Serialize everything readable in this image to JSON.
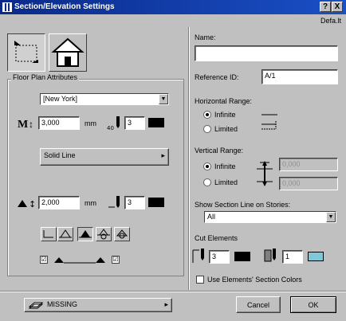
{
  "window": {
    "title": "Section/Elevation Settings",
    "help_label": "?",
    "close_label": "X",
    "defaults_label": "Defa.lt"
  },
  "floor_plan": {
    "group_label": "Floor Plan Attributes",
    "font_value": "[New York]",
    "text_size_value": "3,000",
    "text_size_unit": "mm",
    "pen1_value": "3",
    "line_type_label": "Solid Line",
    "marker_size_value": "2,000",
    "marker_unit": "mm",
    "pen2_value": "3",
    "check_left": "☑",
    "check_right": "☑"
  },
  "name": {
    "label": "Name:",
    "value": ""
  },
  "reference": {
    "label": "Reference ID:",
    "value": "A/1"
  },
  "horizontal_range": {
    "label": "Horizontal Range:",
    "infinite": "Infinite",
    "limited": "Limited"
  },
  "vertical_range": {
    "label": "Vertical Range:",
    "infinite": "Infinite",
    "limited": "Limited",
    "top_value": "0,000",
    "bottom_value": "0,000"
  },
  "show_on_stories": {
    "label": "Show Section Line on Stories:",
    "value": "All"
  },
  "cut_elements": {
    "label": "Cut Elements",
    "pen1_value": "3",
    "pen2_value": "1",
    "use_colors_label": "Use Elements' Section Colors"
  },
  "footer": {
    "layer_label": "MISSING",
    "cancel_label": "Cancel",
    "ok_label": "OK"
  },
  "colors": {
    "titlebar": "#0a2a8a",
    "swatch_black": "#000000",
    "swatch_cyan": "#80c8d8"
  }
}
